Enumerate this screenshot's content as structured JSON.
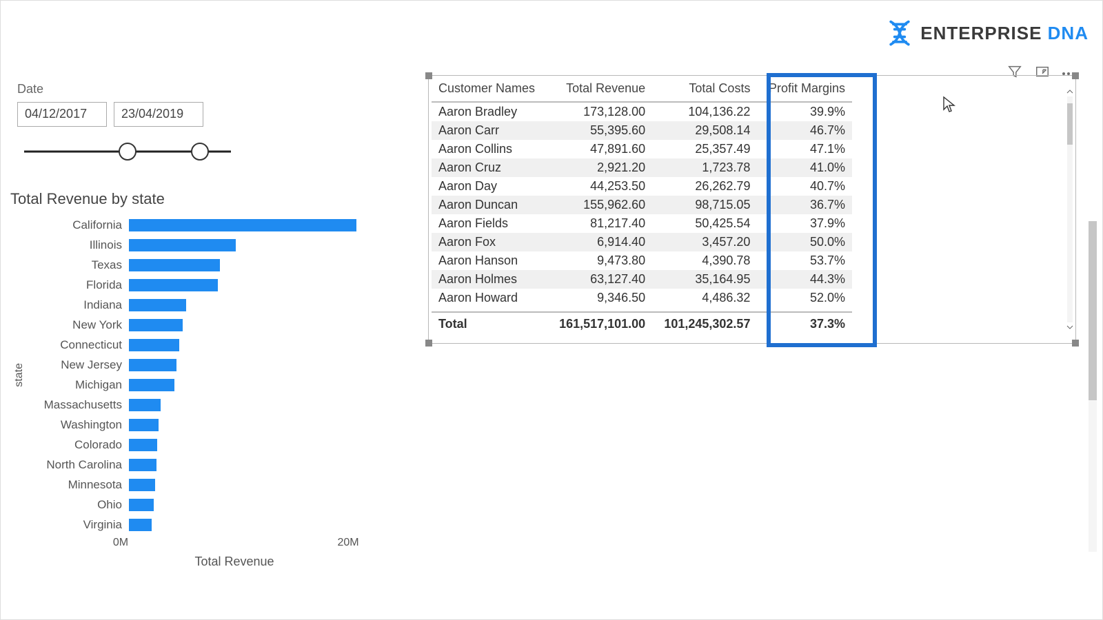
{
  "brand": {
    "name1": "ENTERPRISE",
    "name2": "DNA"
  },
  "slicer": {
    "label": "Date",
    "start": "04/12/2017",
    "end": "23/04/2019"
  },
  "chart_data": {
    "type": "bar",
    "title": "Total Revenue by state",
    "xlabel": "Total Revenue",
    "ylabel": "state",
    "xlim": [
      0,
      20000000
    ],
    "ticks": [
      {
        "value": 0,
        "label": "0M"
      },
      {
        "value": 20000000,
        "label": "20M"
      }
    ],
    "categories": [
      "California",
      "Illinois",
      "Texas",
      "Florida",
      "Indiana",
      "New York",
      "Connecticut",
      "New Jersey",
      "Michigan",
      "Massachusetts",
      "Washington",
      "Colorado",
      "North Carolina",
      "Minnesota",
      "Ohio",
      "Virginia"
    ],
    "values": [
      20000000,
      9400000,
      8000000,
      7800000,
      5000000,
      4700000,
      4400000,
      4200000,
      4000000,
      2800000,
      2600000,
      2500000,
      2400000,
      2300000,
      2200000,
      2000000
    ]
  },
  "table": {
    "headers": [
      "Customer Names",
      "Total Revenue",
      "Total Costs",
      "Profit Margins"
    ],
    "rows": [
      {
        "name": "Aaron Bradley",
        "rev": "173,128.00",
        "cost": "104,136.22",
        "pm": "39.9%"
      },
      {
        "name": "Aaron Carr",
        "rev": "55,395.60",
        "cost": "29,508.14",
        "pm": "46.7%"
      },
      {
        "name": "Aaron Collins",
        "rev": "47,891.60",
        "cost": "25,357.49",
        "pm": "47.1%"
      },
      {
        "name": "Aaron Cruz",
        "rev": "2,921.20",
        "cost": "1,723.78",
        "pm": "41.0%"
      },
      {
        "name": "Aaron Day",
        "rev": "44,253.50",
        "cost": "26,262.79",
        "pm": "40.7%"
      },
      {
        "name": "Aaron Duncan",
        "rev": "155,962.60",
        "cost": "98,715.05",
        "pm": "36.7%"
      },
      {
        "name": "Aaron Fields",
        "rev": "81,217.40",
        "cost": "50,425.54",
        "pm": "37.9%"
      },
      {
        "name": "Aaron Fox",
        "rev": "6,914.40",
        "cost": "3,457.20",
        "pm": "50.0%"
      },
      {
        "name": "Aaron Hanson",
        "rev": "9,473.80",
        "cost": "4,390.78",
        "pm": "53.7%"
      },
      {
        "name": "Aaron Holmes",
        "rev": "63,127.40",
        "cost": "35,164.95",
        "pm": "44.3%"
      },
      {
        "name": "Aaron Howard",
        "rev": "9,346.50",
        "cost": "4,486.32",
        "pm": "52.0%"
      }
    ],
    "total": {
      "label": "Total",
      "rev": "161,517,101.00",
      "cost": "101,245,302.57",
      "pm": "37.3%"
    }
  }
}
